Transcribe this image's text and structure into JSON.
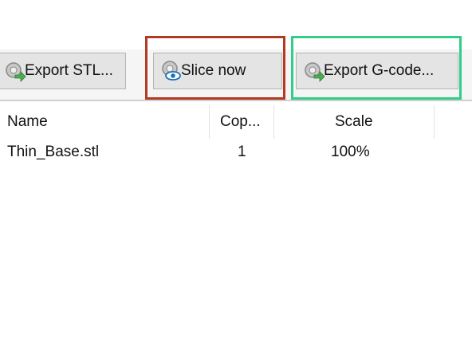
{
  "toolbar": {
    "export_stl_label": "Export STL...",
    "slice_now_label": "Slice now",
    "export_gcode_label": "Export G-code..."
  },
  "highlight_colors": {
    "slice_box": "#b33a22",
    "export_box": "#33cc88"
  },
  "table": {
    "columns": [
      "Name",
      "Cop...",
      "Scale"
    ],
    "rows": [
      {
        "name": "Thin_Base.stl",
        "copies": "1",
        "scale": "100%"
      }
    ]
  }
}
